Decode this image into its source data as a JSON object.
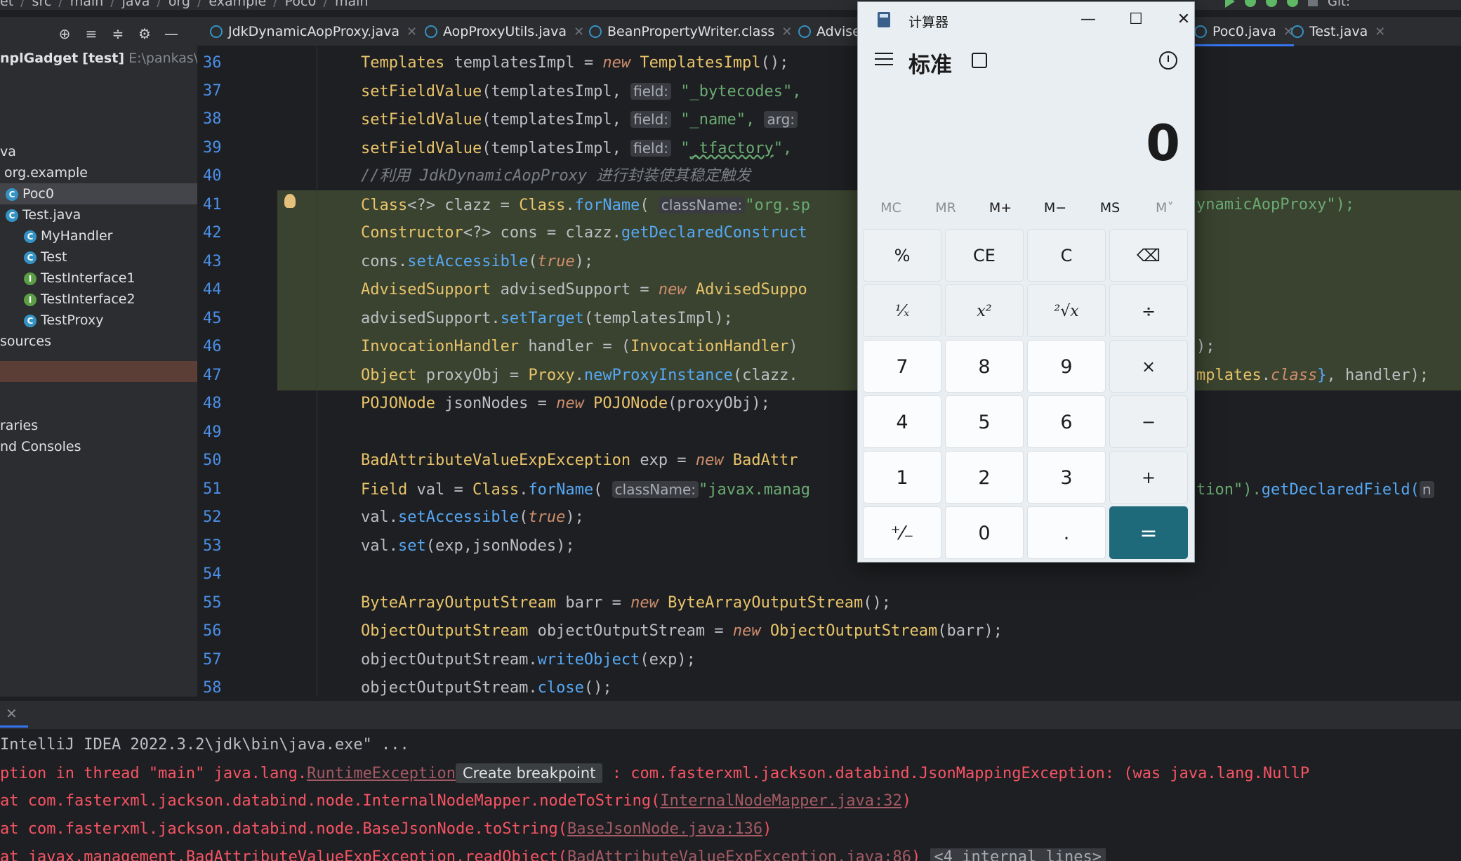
{
  "breadcrumb": [
    "et",
    "src",
    "main",
    "java",
    "org",
    "example",
    "Poc0",
    "main"
  ],
  "toolbar": {
    "git_label": "Git:"
  },
  "project": {
    "items": [
      {
        "label": "nplGadget",
        "suffix": "[test]",
        "path": "E:\\pankas\\javas"
      },
      {
        "label": "va"
      },
      {
        "label": "org.example"
      },
      {
        "label": "Poc0"
      },
      {
        "label": "Test.java"
      },
      {
        "label": "MyHandler"
      },
      {
        "label": "Test"
      },
      {
        "label": "TestInterface1"
      },
      {
        "label": "TestInterface2"
      },
      {
        "label": "TestProxy"
      },
      {
        "label": "sources"
      },
      {
        "label": "raries"
      },
      {
        "label": "nd Consoles"
      }
    ]
  },
  "tabs": [
    {
      "label": "JdkDynamicAopProxy.java"
    },
    {
      "label": "AopProxyUtils.java"
    },
    {
      "label": "BeanPropertyWriter.class"
    },
    {
      "label": "Advised"
    },
    {
      "label": "Poc0.java"
    },
    {
      "label": "Test.java"
    }
  ],
  "editor": {
    "line_numbers": [
      "36",
      "37",
      "38",
      "39",
      "40",
      "41",
      "42",
      "43",
      "44",
      "45",
      "46",
      "47",
      "48",
      "49",
      "50",
      "51",
      "52",
      "53",
      "54",
      "55",
      "56",
      "57",
      "58"
    ],
    "hints": {
      "field": "field:",
      "arg": "arg:",
      "classname": "className:"
    },
    "strings": {
      "s37": "\"_bytecodes\",",
      "s38": "\"_name\",",
      "s39a": "\"",
      "s39b": "_tfactory",
      "s39c": "\",",
      "s41": "\"org.sp",
      "s41b": "ynamicAopProxy\");",
      "s51": "\"javax.manag",
      "s51b": "tion\").",
      "s51c": "getDeclaredField(",
      "s51d": "n"
    },
    "comment40": "//利用 JdkDynamicAopProxy 进行封装使其稳定触发"
  },
  "console": {
    "line1": "IntelliJ IDEA 2022.3.2\\jdk\\bin\\java.exe\" ...",
    "line2_pre": "ption in thread \"main\" java.lang.",
    "line2_link": "RuntimeException",
    "line2_popup": "Create breakpoint",
    "line2_post": " : com.fasterxml.jackson.databind.JsonMappingException: (was java.lang.NullP",
    "line3_pre": "at com.fasterxml.jackson.databind.node.InternalNodeMapper.nodeToString(",
    "line3_link": "InternalNodeMapper.java:32",
    "line3_post": ")",
    "line4_pre": "at com.fasterxml.jackson.databind.node.BaseJsonNode.toString(",
    "line4_link": "BaseJsonNode.java:136",
    "line4_post": ")",
    "line5_pre": "at javax.management.BadAttributeValueExpException.readObject(",
    "line5_link": "BadAttributeValueExpException.java:86",
    "line5_post": ") ",
    "line5_tag": "<4 internal lines>"
  },
  "calculator": {
    "title": "计算器",
    "mode": "标准",
    "display": "0",
    "memory": [
      "MC",
      "MR",
      "M+",
      "M−",
      "MS",
      "M˅"
    ],
    "keys": [
      "%",
      "CE",
      "C",
      "⌫",
      "¹⁄ₓ",
      "x²",
      "²√x",
      "÷",
      "7",
      "8",
      "9",
      "×",
      "4",
      "5",
      "6",
      "−",
      "1",
      "2",
      "3",
      "+",
      "⁺⁄₋",
      "0",
      ".",
      "="
    ]
  }
}
